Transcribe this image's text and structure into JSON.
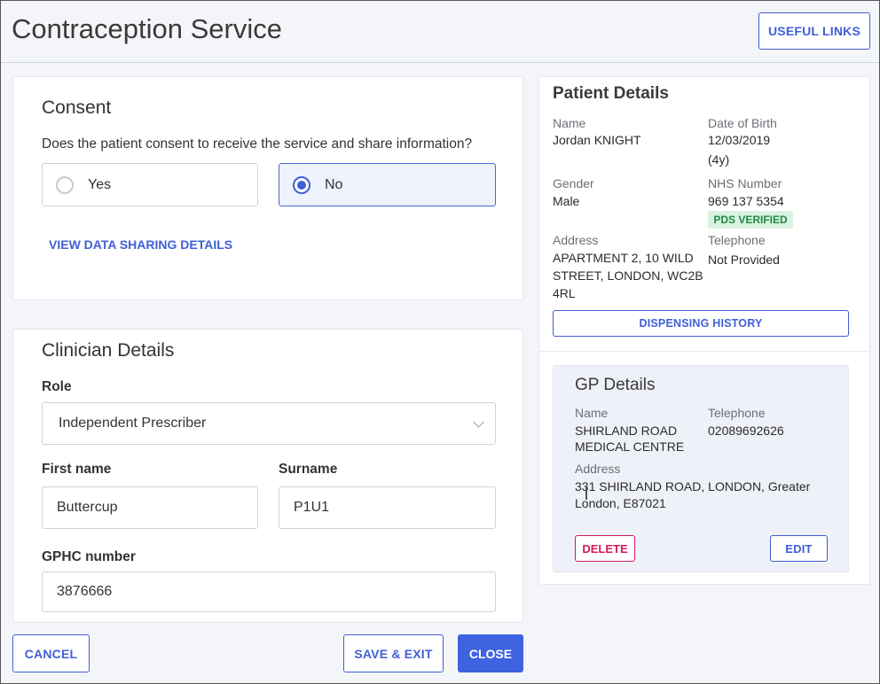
{
  "header": {
    "title": "Contraception Service",
    "useful_links_label": "USEFUL LINKS"
  },
  "consent": {
    "title": "Consent",
    "question": "Does the patient consent to receive the service and share information?",
    "options": [
      {
        "label": "Yes",
        "selected": false
      },
      {
        "label": "No",
        "selected": true
      }
    ],
    "view_details_label": "VIEW DATA SHARING DETAILS"
  },
  "clinician": {
    "title": "Clinician Details",
    "role_label": "Role",
    "role_value": "Independent Prescriber",
    "first_name_label": "First name",
    "first_name_value": "Buttercup",
    "surname_label": "Surname",
    "surname_value": "P1U1",
    "gphc_label": "GPHC number",
    "gphc_value": "3876666"
  },
  "patient": {
    "title": "Patient Details",
    "name_label": "Name",
    "name_value": "Jordan KNIGHT",
    "dob_label": "Date of Birth",
    "dob_value": "12/03/2019",
    "age_value": "(4y)",
    "gender_label": "Gender",
    "gender_value": "Male",
    "nhs_label": "NHS Number",
    "nhs_value": "969 137 5354",
    "pds_badge": "PDS VERIFIED",
    "address_label": "Address",
    "address_line1": "APARTMENT 2, 10 WILD",
    "address_line2": "STREET, LONDON, WC2B",
    "address_line3": "4RL",
    "telephone_label": "Telephone",
    "telephone_value": "Not Provided",
    "dispensing_history_label": "DISPENSING HISTORY"
  },
  "gp": {
    "title": "GP Details",
    "name_label": "Name",
    "name_line1": "SHIRLAND ROAD",
    "name_line2": "MEDICAL CENTRE",
    "telephone_label": "Telephone",
    "telephone_value": "02089692626",
    "address_label": "Address",
    "address_line1": "331 SHIRLAND ROAD, LONDON, Greater",
    "address_line2": "London, E87021",
    "delete_label": "DELETE",
    "edit_label": "EDIT"
  },
  "footer": {
    "cancel_label": "CANCEL",
    "save_exit_label": "SAVE & EXIT",
    "close_label": "CLOSE"
  },
  "colors": {
    "accent": "#3f5fd6",
    "danger": "#d01a5e",
    "success": "#1f8a45"
  }
}
